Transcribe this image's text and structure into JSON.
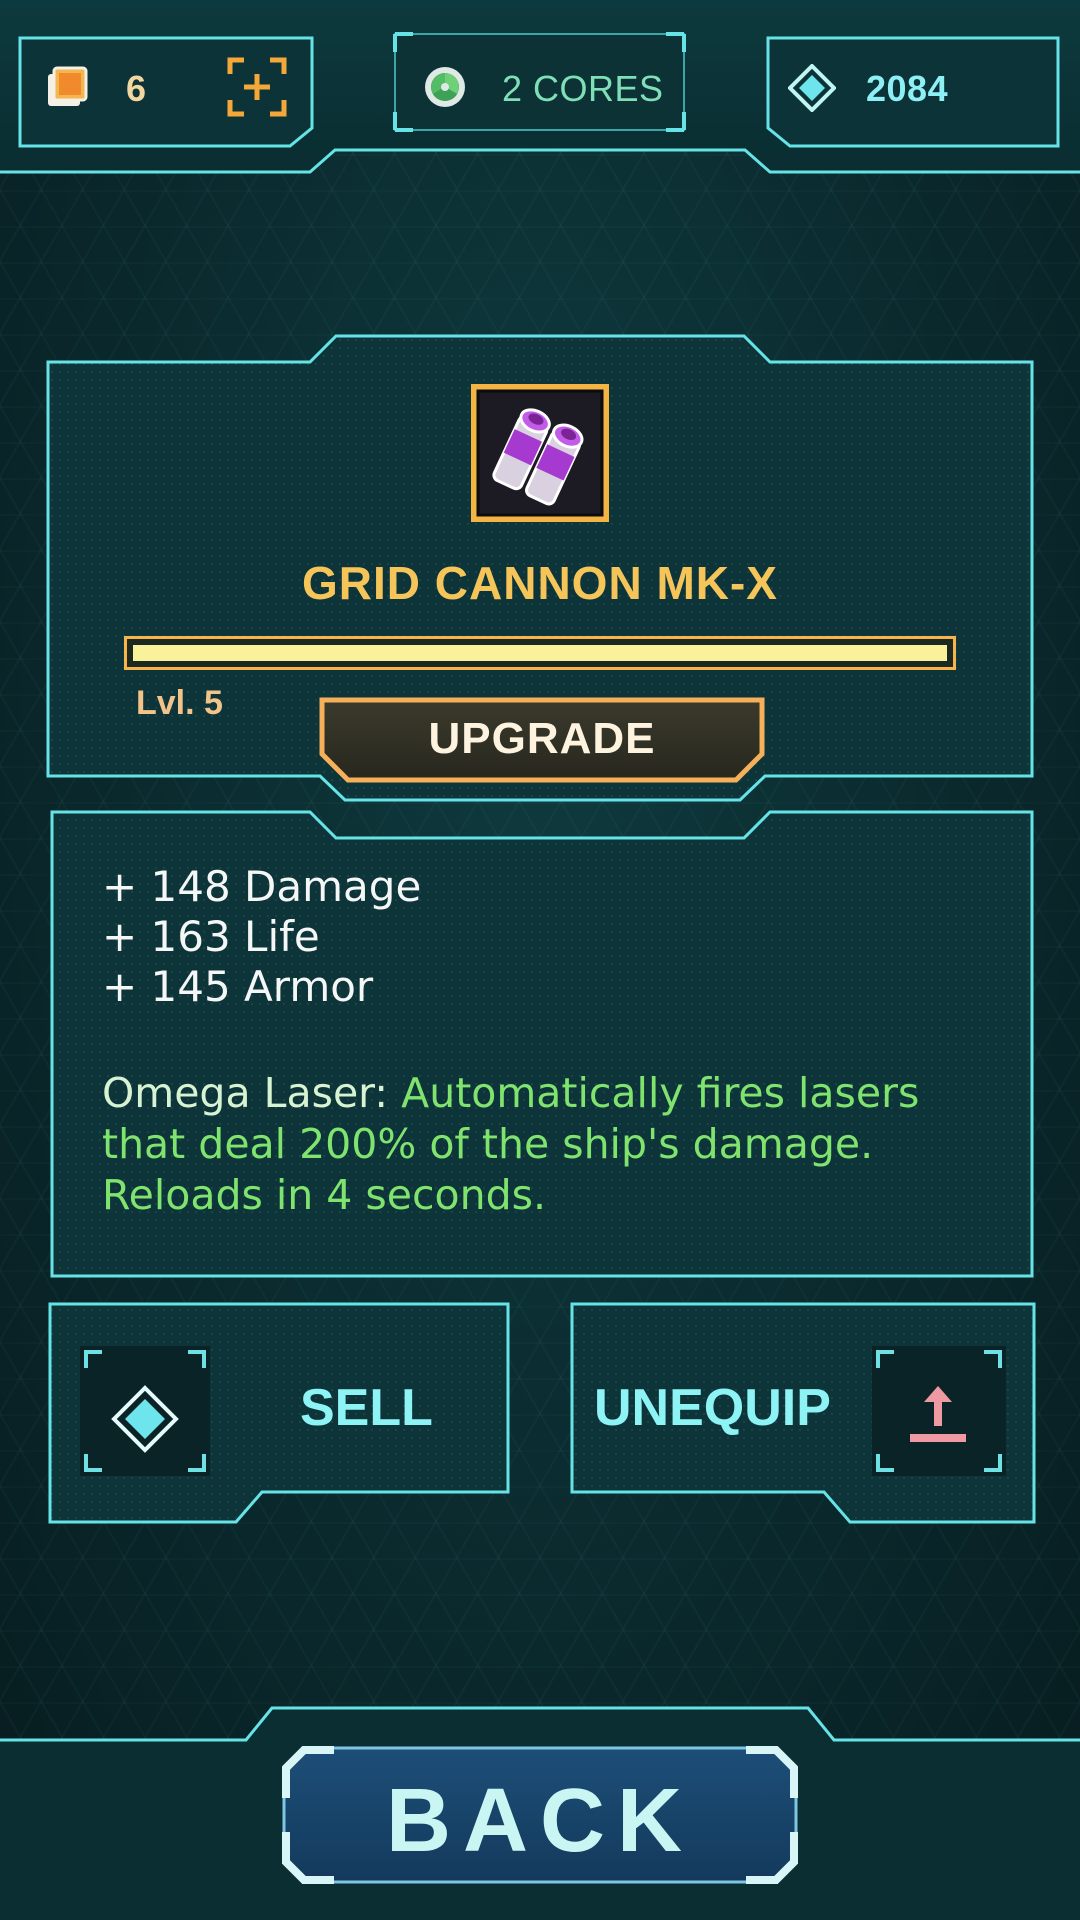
{
  "topbar": {
    "cards_count": "6",
    "cores_label": "2 CORES",
    "gems_count": "2084"
  },
  "item": {
    "name": "GRID CANNON MK-X",
    "level_label": "Lvl. 5",
    "xp_progress": 1.0,
    "upgrade_label": "UPGRADE"
  },
  "stats": {
    "lines": [
      "+ 148 Damage",
      "+ 163 Life",
      "+ 145 Armor"
    ],
    "ability_name": "Omega Laser:",
    "ability_text": " Automatically fires lasers that deal 200% of the ship's damage. Reloads in 4 seconds."
  },
  "actions": {
    "sell_label": "SELL",
    "unequip_label": "UNEQUIP"
  },
  "footer": {
    "back_label": "BACK"
  },
  "colors": {
    "frame": "#66e3e6",
    "accent_gold": "#f6c55a",
    "ability_green": "#7fe36d",
    "unequip_arrow": "#ef9aa2"
  }
}
